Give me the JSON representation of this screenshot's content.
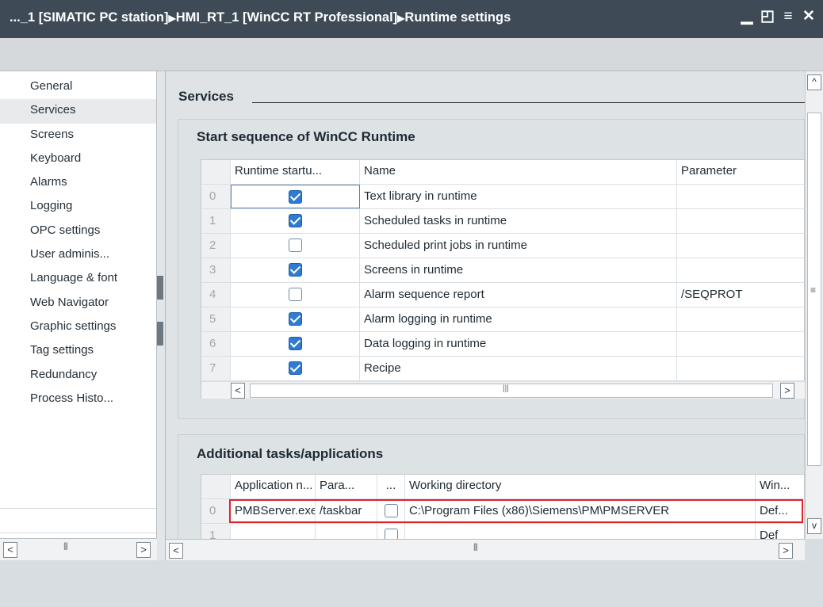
{
  "titlebar": {
    "crumb1": "..._1 [SIMATIC PC station]",
    "crumb2": "HMI_RT_1 [WinCC RT Professional]",
    "crumb3": "Runtime settings"
  },
  "nav": {
    "items": [
      "General",
      "Services",
      "Screens",
      "Keyboard",
      "Alarms",
      "Logging",
      "OPC settings",
      "User adminis...",
      "Language & font",
      "Web Navigator",
      "Graphic settings",
      "Tag settings",
      "Redundancy",
      "Process Histo..."
    ],
    "selected": "Services"
  },
  "section": {
    "title": "Services"
  },
  "start_sequence": {
    "title": "Start sequence of WinCC Runtime",
    "columns": [
      "Runtime startu...",
      "Name",
      "Parameter"
    ],
    "rows": [
      {
        "index": "0",
        "checked": true,
        "name": "Text library in runtime",
        "param": ""
      },
      {
        "index": "1",
        "checked": true,
        "name": "Scheduled tasks in runtime",
        "param": ""
      },
      {
        "index": "2",
        "checked": false,
        "name": "Scheduled print jobs in runtime",
        "param": ""
      },
      {
        "index": "3",
        "checked": true,
        "name": "Screens in runtime",
        "param": ""
      },
      {
        "index": "4",
        "checked": false,
        "name": "Alarm sequence report",
        "param": "/SEQPROT"
      },
      {
        "index": "5",
        "checked": true,
        "name": "Alarm logging in runtime",
        "param": ""
      },
      {
        "index": "6",
        "checked": true,
        "name": "Data logging in runtime",
        "param": ""
      },
      {
        "index": "7",
        "checked": true,
        "name": "Recipe",
        "param": ""
      }
    ]
  },
  "additional": {
    "title": "Additional tasks/applications",
    "columns": [
      "Application n...",
      "Para...",
      "...",
      "Working directory",
      "Win..."
    ],
    "rows": [
      {
        "index": "0",
        "app": "PMBServer.exe",
        "param": "/taskbar",
        "checked": false,
        "workdir": "C:\\Program Files (x86)\\Siemens\\PM\\PMSERVER",
        "win": "Def..."
      },
      {
        "index": "1",
        "app": "",
        "param": "",
        "checked": false,
        "workdir": "",
        "win": "Def"
      }
    ]
  },
  "colors": {
    "titlebar": "#3e4b57",
    "checkbox_on": "#2f7bd3",
    "highlight": "#e0222b"
  }
}
